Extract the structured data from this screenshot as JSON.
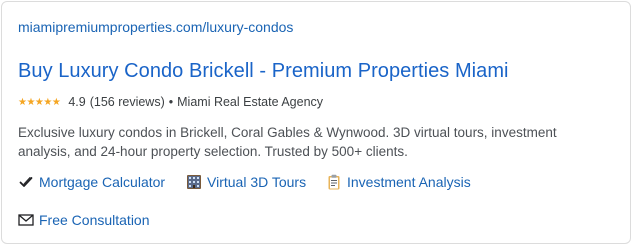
{
  "result": {
    "url": "miamipremiumproperties.com/luxury-condos",
    "title": "Buy Luxury Condo Brickell - Premium Properties Miami",
    "stars": "★★★★★",
    "rating": "4.9",
    "reviews": "(156 reviews)",
    "separator": "•",
    "agency": "Miami Real Estate Agency",
    "description": "Exclusive luxury condos in Brickell, Coral Gables & Wynwood. 3D virtual tours, investment analysis, and 24-hour property selection. Trusted by 500+ clients."
  },
  "sitelinks": {
    "mortgage": {
      "label": "Mortgage Calculator",
      "icon": "checkmark-icon"
    },
    "tours": {
      "label": "Virtual 3D Tours",
      "icon": "building-icon"
    },
    "investment": {
      "label": "Investment Analysis",
      "icon": "clipboard-icon"
    },
    "consultation": {
      "label": "Free Consultation",
      "icon": "envelope-icon"
    }
  },
  "colors": {
    "link": "#1a64b4",
    "title": "#1a64c8",
    "stars": "#f5a623",
    "text": "#4d5156"
  }
}
